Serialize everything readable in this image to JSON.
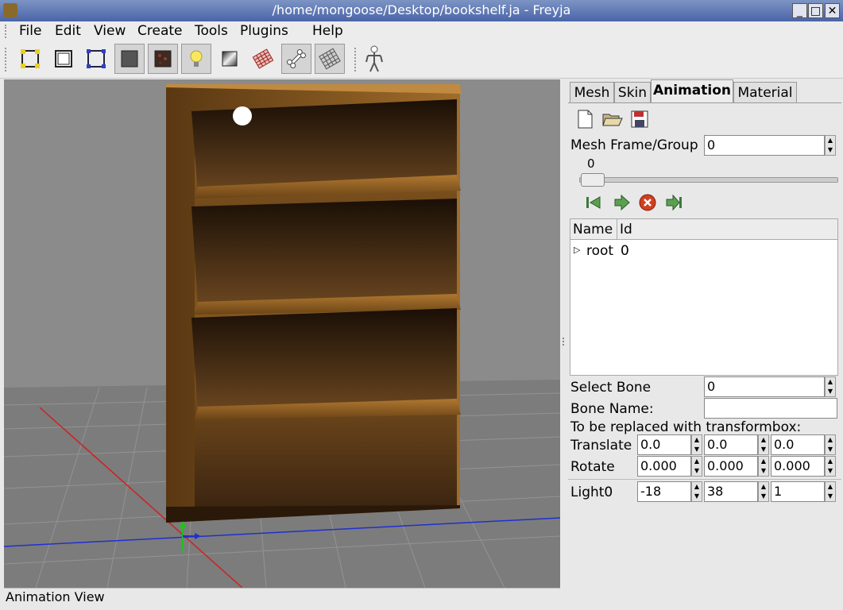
{
  "window": {
    "title": "/home/mongoose/Desktop/bookshelf.ja - Freyja"
  },
  "menu": [
    "File",
    "Edit",
    "View",
    "Create",
    "Tools",
    "Plugins",
    "Help"
  ],
  "toolbar": [
    {
      "icon": "vertex-select-icon"
    },
    {
      "icon": "face-select-icon"
    },
    {
      "icon": "bbox-select-icon"
    },
    {
      "icon": "solid-render-icon",
      "pressed": true
    },
    {
      "icon": "texture-render-icon",
      "pressed": true
    },
    {
      "icon": "lighting-icon",
      "pressed": true
    },
    {
      "icon": "material-icon"
    },
    {
      "icon": "wireframe-icon"
    },
    {
      "icon": "bone-icon",
      "pressed": true
    },
    {
      "icon": "grid-icon",
      "pressed": true
    },
    {
      "icon": "skeleton-icon"
    }
  ],
  "viewport": {
    "status": "Animation View"
  },
  "panel": {
    "tabs": [
      "Mesh",
      "Skin",
      "Animation",
      "Material"
    ],
    "active_tab": "Animation",
    "file_icons": [
      "new-file-icon",
      "open-folder-icon",
      "save-disk-icon"
    ],
    "mesh_frame_label": "Mesh Frame/Group",
    "mesh_frame_value": "0",
    "slider_value": "0",
    "playback_icons": [
      "first-frame-icon",
      "play-icon",
      "stop-icon",
      "last-frame-icon"
    ],
    "tree": {
      "columns": [
        "Name",
        "Id"
      ],
      "rows": [
        {
          "name": "root",
          "id": "0"
        }
      ]
    },
    "select_bone_label": "Select Bone",
    "select_bone_value": "0",
    "bone_name_label": "Bone Name:",
    "bone_name_value": "",
    "transform_note": "To be replaced with transformbox:",
    "translate_label": "Translate",
    "translate": [
      "0.0",
      "0.0",
      "0.0"
    ],
    "rotate_label": "Rotate",
    "rotate": [
      "0.000",
      "0.000",
      "0.000"
    ],
    "light_label": "Light0",
    "light": [
      "-18",
      "38",
      "1"
    ]
  }
}
